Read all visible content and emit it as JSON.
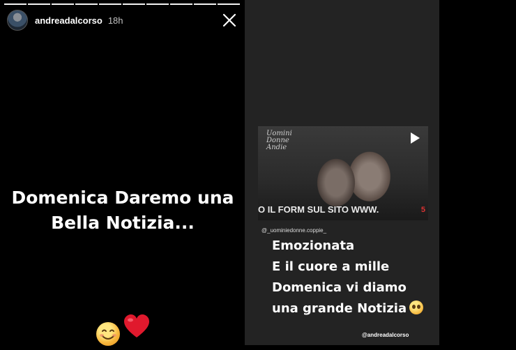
{
  "left_story": {
    "progress_segments": 10,
    "progress_done": 10,
    "username": "andreadalcorso",
    "time": "18h",
    "caption_line1": "Domenica Daremo una",
    "caption_line2": "Bella Notizia..."
  },
  "right_story": {
    "video": {
      "logo_line1": "Uomini",
      "logo_line2": "Donne",
      "logo_line3": "Andie",
      "ticker_text": "O IL FORM SUL SITO WWW.",
      "channel": "5"
    },
    "source_handle": "@_uominiedonne.coppie_",
    "caption_lines": [
      "Emozionata",
      "E il cuore a mille",
      "Domenica vi diamo",
      "una grande Notizia"
    ],
    "mention": "@andreadalcorso"
  },
  "colors": {
    "background": "#000000",
    "panel": "#232323",
    "heart": "#e0192d",
    "smile": "#f7b53b"
  }
}
